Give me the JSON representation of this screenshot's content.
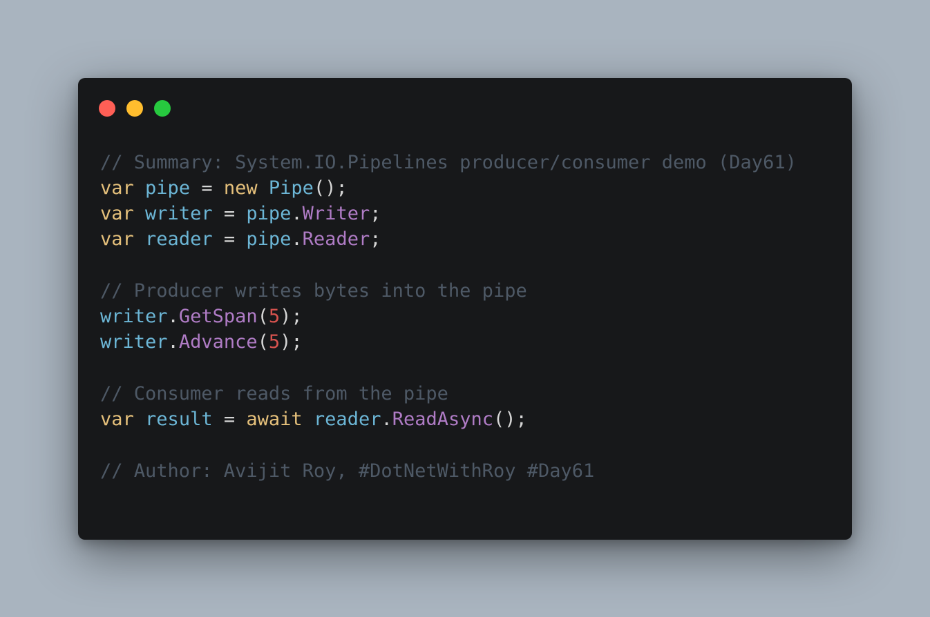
{
  "window": {
    "controls": [
      {
        "name": "close-dot",
        "color": "#ff5f56"
      },
      {
        "name": "minimize-dot",
        "color": "#ffbd2e"
      },
      {
        "name": "zoom-dot",
        "color": "#27c93f"
      }
    ]
  },
  "code": {
    "lines": [
      [
        {
          "t": "// Summary: System.IO.Pipelines producer/consumer demo (Day61)",
          "k": "comment"
        }
      ],
      [
        {
          "t": "var",
          "k": "keyword"
        },
        {
          "t": " ",
          "k": "punct"
        },
        {
          "t": "pipe",
          "k": "ident"
        },
        {
          "t": " = ",
          "k": "punct"
        },
        {
          "t": "new",
          "k": "keyword"
        },
        {
          "t": " ",
          "k": "punct"
        },
        {
          "t": "Pipe",
          "k": "type"
        },
        {
          "t": "();",
          "k": "punct"
        }
      ],
      [
        {
          "t": "var",
          "k": "keyword"
        },
        {
          "t": " ",
          "k": "punct"
        },
        {
          "t": "writer",
          "k": "ident"
        },
        {
          "t": " = ",
          "k": "punct"
        },
        {
          "t": "pipe",
          "k": "ident"
        },
        {
          "t": ".",
          "k": "punct"
        },
        {
          "t": "Writer",
          "k": "member"
        },
        {
          "t": ";",
          "k": "punct"
        }
      ],
      [
        {
          "t": "var",
          "k": "keyword"
        },
        {
          "t": " ",
          "k": "punct"
        },
        {
          "t": "reader",
          "k": "ident"
        },
        {
          "t": " = ",
          "k": "punct"
        },
        {
          "t": "pipe",
          "k": "ident"
        },
        {
          "t": ".",
          "k": "punct"
        },
        {
          "t": "Reader",
          "k": "member"
        },
        {
          "t": ";",
          "k": "punct"
        }
      ],
      [],
      [
        {
          "t": "// Producer writes bytes into the pipe",
          "k": "comment"
        }
      ],
      [
        {
          "t": "writer",
          "k": "ident"
        },
        {
          "t": ".",
          "k": "punct"
        },
        {
          "t": "GetSpan",
          "k": "member"
        },
        {
          "t": "(",
          "k": "punct"
        },
        {
          "t": "5",
          "k": "number"
        },
        {
          "t": ");",
          "k": "punct"
        }
      ],
      [
        {
          "t": "writer",
          "k": "ident"
        },
        {
          "t": ".",
          "k": "punct"
        },
        {
          "t": "Advance",
          "k": "member"
        },
        {
          "t": "(",
          "k": "punct"
        },
        {
          "t": "5",
          "k": "number"
        },
        {
          "t": ");",
          "k": "punct"
        }
      ],
      [],
      [
        {
          "t": "// Consumer reads from the pipe",
          "k": "comment"
        }
      ],
      [
        {
          "t": "var",
          "k": "keyword"
        },
        {
          "t": " ",
          "k": "punct"
        },
        {
          "t": "result",
          "k": "ident"
        },
        {
          "t": " = ",
          "k": "punct"
        },
        {
          "t": "await",
          "k": "keyword"
        },
        {
          "t": " ",
          "k": "punct"
        },
        {
          "t": "reader",
          "k": "ident"
        },
        {
          "t": ".",
          "k": "punct"
        },
        {
          "t": "ReadAsync",
          "k": "member"
        },
        {
          "t": "();",
          "k": "punct"
        }
      ],
      [],
      [
        {
          "t": "// Author: Avijit Roy, #DotNetWithRoy #Day61",
          "k": "comment"
        }
      ]
    ]
  }
}
